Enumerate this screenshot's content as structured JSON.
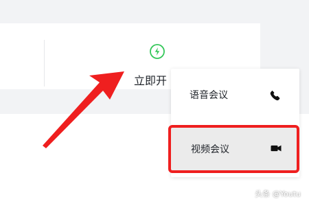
{
  "toolbar": {
    "start_label": "立即开",
    "start_icon": "lightning-icon"
  },
  "menu": {
    "items": [
      {
        "label": "语音会议",
        "icon": "phone-icon"
      },
      {
        "label": "视频会议",
        "icon": "video-camera-icon"
      }
    ],
    "highlight_color": "#ef1f1f"
  },
  "annotation": {
    "arrow_color": "#ef1f1f"
  },
  "watermark": {
    "text": "头条 @Youtu"
  },
  "colors": {
    "accent": "#34c759",
    "background": "#f2f3f5",
    "text": "#1f2329"
  }
}
